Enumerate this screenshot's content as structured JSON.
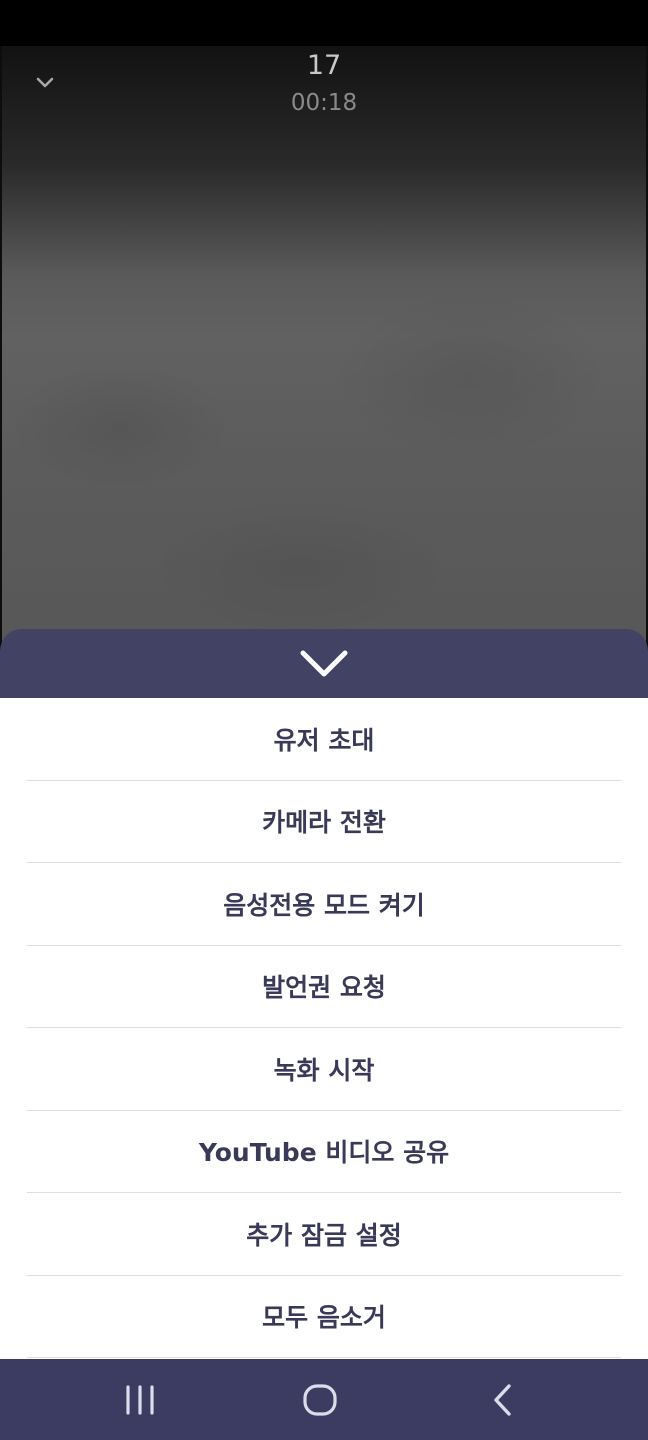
{
  "call": {
    "number": "17",
    "timer": "00:18"
  },
  "menu": {
    "items": [
      {
        "label": "유저 초대"
      },
      {
        "label": "카메라 전환"
      },
      {
        "label": "음성전용 모드 켜기"
      },
      {
        "label": "발언권 요청"
      },
      {
        "label": "녹화 시작"
      },
      {
        "label": "YouTube 비디오 공유"
      },
      {
        "label": "추가 잠금 설정"
      },
      {
        "label": "모두 음소거"
      }
    ]
  },
  "icons": {
    "collapse": "chevron-down-icon",
    "sheet_close": "chevron-down-icon",
    "nav_recents": "recents-icon",
    "nav_home": "home-icon",
    "nav_back": "back-icon"
  },
  "colors": {
    "sheet_header": "#424265",
    "nav_bar": "#3c3c63",
    "menu_text": "#3a3a58",
    "menu_background": "#ffffff"
  }
}
